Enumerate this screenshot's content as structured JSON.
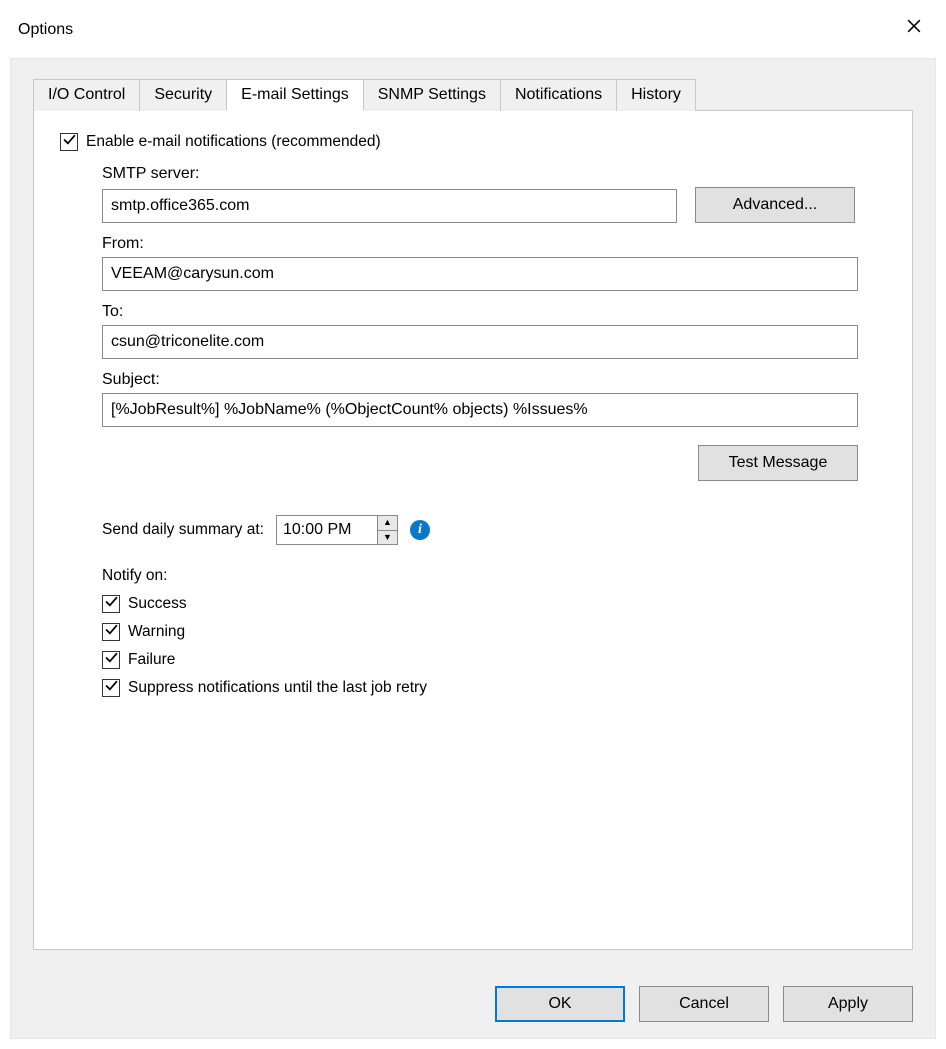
{
  "window": {
    "title": "Options"
  },
  "tabs": {
    "io_control": "I/O Control",
    "security": "Security",
    "email_settings": "E-mail Settings",
    "snmp_settings": "SNMP Settings",
    "notifications": "Notifications",
    "history": "History"
  },
  "email": {
    "enable_label": "Enable e-mail notifications (recommended)",
    "smtp_label": "SMTP server:",
    "smtp_value": "smtp.office365.com",
    "advanced_btn": "Advanced...",
    "from_label": "From:",
    "from_value": "VEEAM@carysun.com",
    "to_label": "To:",
    "to_value": "csun@triconelite.com",
    "subject_label": "Subject:",
    "subject_value": "[%JobResult%] %JobName% (%ObjectCount% objects) %Issues%",
    "test_btn": "Test Message",
    "summary_label": "Send daily summary at:",
    "summary_time": "10:00 PM",
    "notify_label": "Notify on:",
    "notify_success": "Success",
    "notify_warning": "Warning",
    "notify_failure": "Failure",
    "notify_suppress": "Suppress notifications until the last job retry"
  },
  "footer": {
    "ok": "OK",
    "cancel": "Cancel",
    "apply": "Apply"
  }
}
